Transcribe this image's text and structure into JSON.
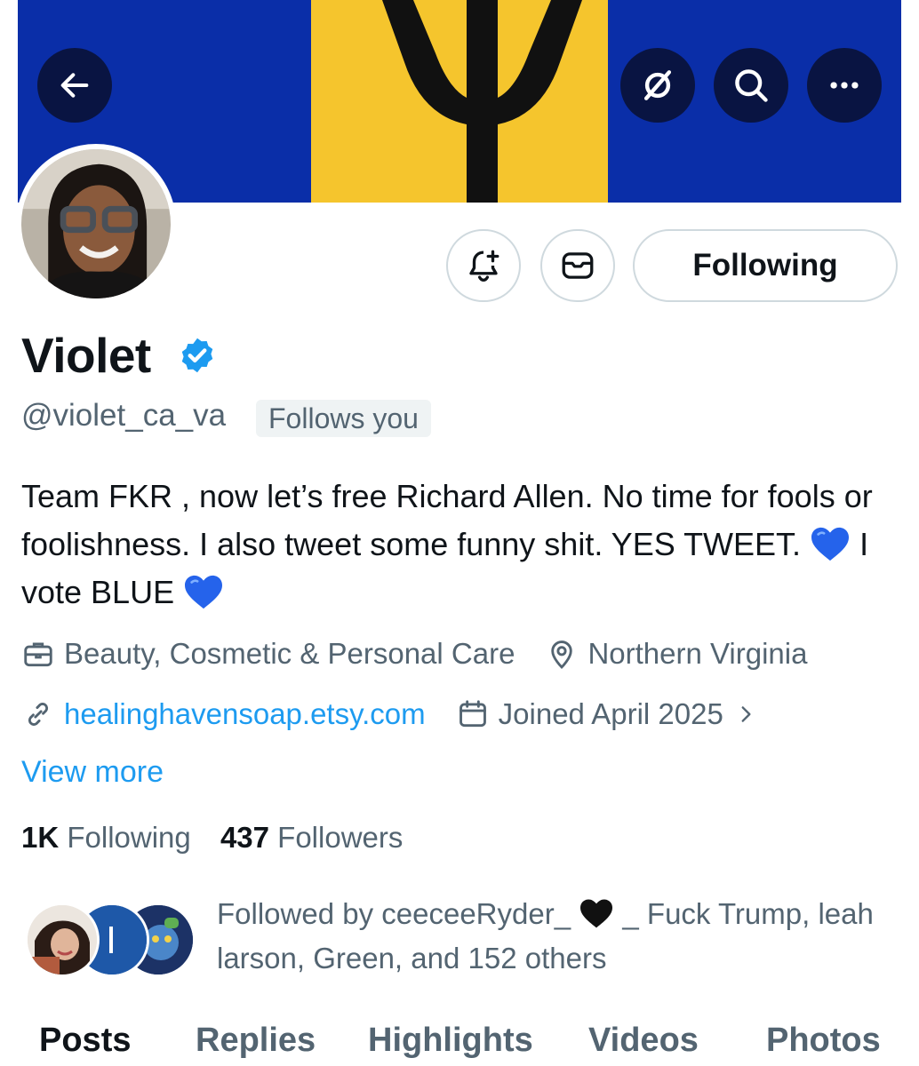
{
  "header": {
    "back_icon": "arrow-left-icon",
    "grok_icon": "grok-slash-icon",
    "search_icon": "search-icon",
    "more_icon": "more-dots-icon"
  },
  "actions": {
    "notify_icon": "bell-plus-icon",
    "message_icon": "mail-icon",
    "following_label": "Following"
  },
  "profile": {
    "name": "Violet",
    "handle": "@violet_ca_va",
    "follows_you": "Follows you",
    "bio_part1": "Team FKR , now let’s free Richard Allen. No time for fools or foolishness. I also tweet some funny shit. YES TWEET. ",
    "bio_part2": " I vote BLUE ",
    "category": "Beauty, Cosmetic & Personal Care",
    "location": "Northern Virginia",
    "website": "healinghavensoap.etsy.com",
    "joined": "Joined April 2025",
    "view_more": "View more",
    "following_count": "1K",
    "following_label": "Following",
    "followers_count": "437",
    "followers_label": "Followers",
    "followed_by_part1": "Followed by ceeceeRyder_ ",
    "followed_by_part2": " _ Fuck Trump, leah larson, Green, and 152 others"
  },
  "tabs": [
    "Posts",
    "Replies",
    "Highlights",
    "Videos",
    "Photos"
  ],
  "colors": {
    "flag_blue": "#0a2ea8",
    "flag_gold": "#f5c52d",
    "accent": "#1d9bf0",
    "muted": "#536471"
  }
}
